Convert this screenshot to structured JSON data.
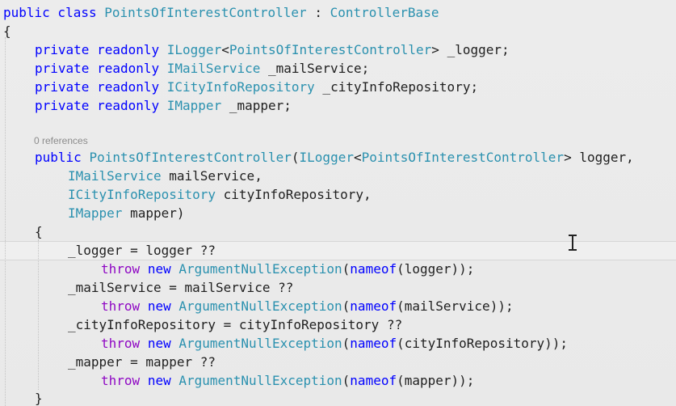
{
  "colors": {
    "keyword": "#0000ff",
    "type": "#2b91af",
    "control": "#8f08c4",
    "method": "#74531f",
    "identifier": "#1f1f1f",
    "codelens": "#8c8c8c"
  },
  "icons": {
    "cursor": "text-cursor-ibeam-icon"
  },
  "codelens": {
    "text": "0 references"
  },
  "code_lines": [
    [
      {
        "t": "public class ",
        "c": "keyword"
      },
      {
        "t": "PointsOfInterestController",
        "c": "type"
      },
      {
        "t": " : ",
        "c": "identifier"
      },
      {
        "t": "ControllerBase",
        "c": "type"
      }
    ],
    [
      {
        "t": "{",
        "c": "identifier"
      }
    ],
    [
      {
        "t": "private readonly ",
        "c": "keyword"
      },
      {
        "t": "ILogger",
        "c": "type"
      },
      {
        "t": "<",
        "c": "identifier"
      },
      {
        "t": "PointsOfInterestController",
        "c": "type"
      },
      {
        "t": "> _logger;",
        "c": "identifier"
      }
    ],
    [
      {
        "t": "private readonly ",
        "c": "keyword"
      },
      {
        "t": "IMailService",
        "c": "type"
      },
      {
        "t": " _mailService;",
        "c": "identifier"
      }
    ],
    [
      {
        "t": "private readonly ",
        "c": "keyword"
      },
      {
        "t": "ICityInfoRepository",
        "c": "type"
      },
      {
        "t": " _cityInfoRepository;",
        "c": "identifier"
      }
    ],
    [
      {
        "t": "private readonly ",
        "c": "keyword"
      },
      {
        "t": "IMapper",
        "c": "type"
      },
      {
        "t": " _mapper;",
        "c": "identifier"
      }
    ],
    [
      {
        "t": "public ",
        "c": "keyword"
      },
      {
        "t": "PointsOfInterestController",
        "c": "type"
      },
      {
        "t": "(",
        "c": "identifier"
      },
      {
        "t": "ILogger",
        "c": "type"
      },
      {
        "t": "<",
        "c": "identifier"
      },
      {
        "t": "PointsOfInterestController",
        "c": "type"
      },
      {
        "t": "> logger,",
        "c": "identifier"
      }
    ],
    [
      {
        "t": "IMailService",
        "c": "type"
      },
      {
        "t": " mailService,",
        "c": "identifier"
      }
    ],
    [
      {
        "t": "ICityInfoRepository",
        "c": "type"
      },
      {
        "t": " cityInfoRepository,",
        "c": "identifier"
      }
    ],
    [
      {
        "t": "IMapper",
        "c": "type"
      },
      {
        "t": " mapper)",
        "c": "identifier"
      }
    ],
    [
      {
        "t": "{",
        "c": "identifier"
      }
    ],
    [
      {
        "t": "_logger = logger ??",
        "c": "identifier"
      }
    ],
    [
      {
        "t": "throw",
        "c": "control"
      },
      {
        "t": " ",
        "c": "identifier"
      },
      {
        "t": "new",
        "c": "keyword"
      },
      {
        "t": " ",
        "c": "identifier"
      },
      {
        "t": "ArgumentNullException",
        "c": "type"
      },
      {
        "t": "(",
        "c": "identifier"
      },
      {
        "t": "nameof",
        "c": "keyword"
      },
      {
        "t": "(logger));",
        "c": "identifier"
      }
    ],
    [
      {
        "t": "_mailService = mailService ??",
        "c": "identifier"
      }
    ],
    [
      {
        "t": "throw",
        "c": "control"
      },
      {
        "t": " ",
        "c": "identifier"
      },
      {
        "t": "new",
        "c": "keyword"
      },
      {
        "t": " ",
        "c": "identifier"
      },
      {
        "t": "ArgumentNullException",
        "c": "type"
      },
      {
        "t": "(",
        "c": "identifier"
      },
      {
        "t": "nameof",
        "c": "keyword"
      },
      {
        "t": "(mailService));",
        "c": "identifier"
      }
    ],
    [
      {
        "t": "_cityInfoRepository = cityInfoRepository ??",
        "c": "identifier"
      }
    ],
    [
      {
        "t": "throw",
        "c": "control"
      },
      {
        "t": " ",
        "c": "identifier"
      },
      {
        "t": "new",
        "c": "keyword"
      },
      {
        "t": " ",
        "c": "identifier"
      },
      {
        "t": "ArgumentNullException",
        "c": "type"
      },
      {
        "t": "(",
        "c": "identifier"
      },
      {
        "t": "nameof",
        "c": "keyword"
      },
      {
        "t": "(cityInfoRepository));",
        "c": "identifier"
      }
    ],
    [
      {
        "t": "_mapper = mapper ??",
        "c": "identifier"
      }
    ],
    [
      {
        "t": "throw",
        "c": "control"
      },
      {
        "t": " ",
        "c": "identifier"
      },
      {
        "t": "new",
        "c": "keyword"
      },
      {
        "t": " ",
        "c": "identifier"
      },
      {
        "t": "ArgumentNullException",
        "c": "type"
      },
      {
        "t": "(",
        "c": "identifier"
      },
      {
        "t": "nameof",
        "c": "keyword"
      },
      {
        "t": "(mapper));",
        "c": "identifier"
      }
    ],
    [
      {
        "t": "}",
        "c": "identifier"
      }
    ]
  ]
}
